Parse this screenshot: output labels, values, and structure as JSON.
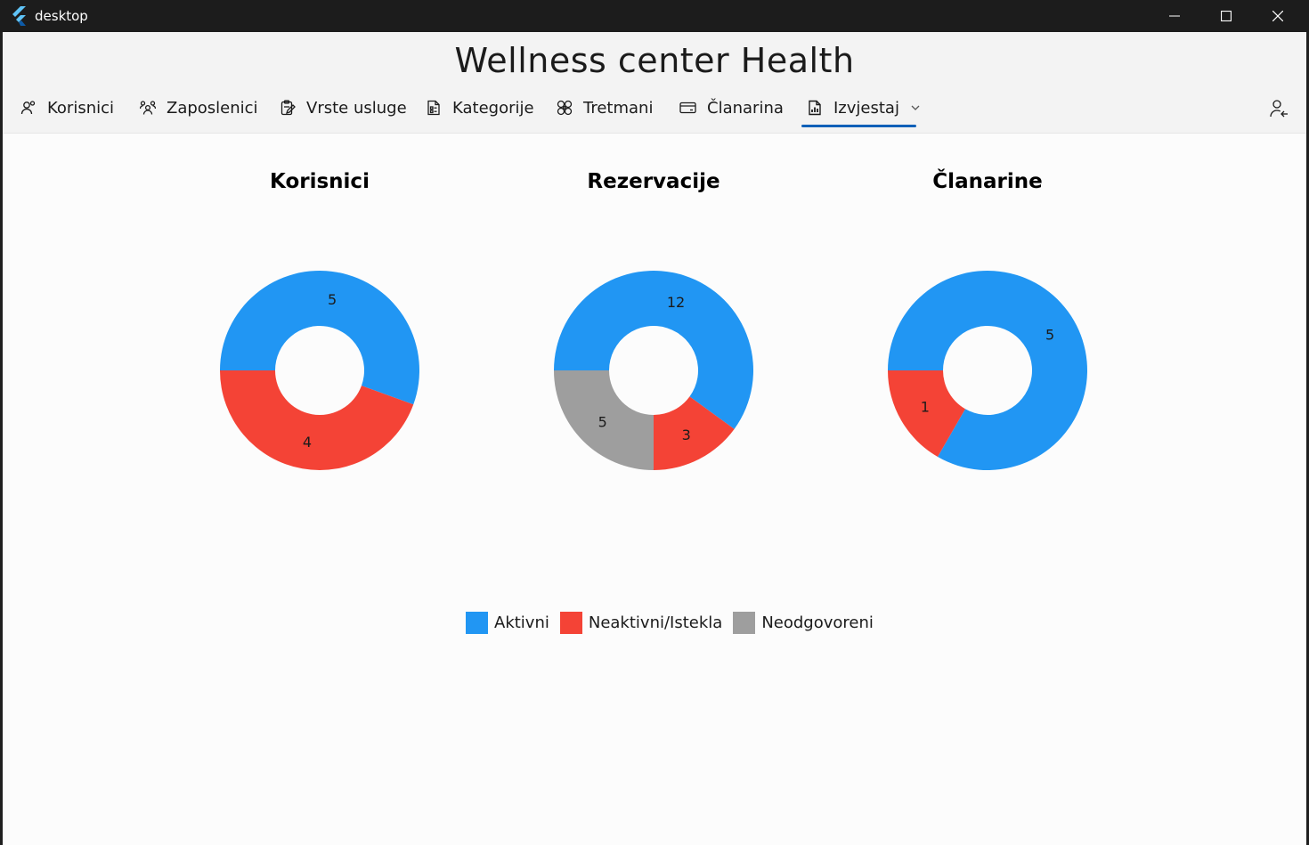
{
  "window": {
    "title": "desktop"
  },
  "app": {
    "title": "Wellness center Health"
  },
  "nav": {
    "items": [
      {
        "label": "Korisnici",
        "icon": "users-icon"
      },
      {
        "label": "Zaposlenici",
        "icon": "team-icon"
      },
      {
        "label": "Vrste usluge",
        "icon": "clipboard-edit-icon"
      },
      {
        "label": "Kategorije",
        "icon": "document-list-icon"
      },
      {
        "label": "Tretmani",
        "icon": "flower-icon"
      },
      {
        "label": "Članarina",
        "icon": "card-icon"
      },
      {
        "label": "Izvjestaj",
        "icon": "report-icon",
        "active": true,
        "dropdown": true
      }
    ],
    "logout_icon": "user-logout-icon"
  },
  "colors": {
    "aktivni": "#2196F3",
    "neaktivni": "#F44336",
    "neodgovoreni": "#9E9E9E",
    "accent": "#1060B8"
  },
  "chart_data": [
    {
      "type": "pie",
      "title": "Korisnici",
      "slices": [
        {
          "label": "Aktivni",
          "value": 5
        },
        {
          "label": "Neaktivni/Istekla",
          "value": 4
        }
      ]
    },
    {
      "type": "pie",
      "title": "Rezervacije",
      "slices": [
        {
          "label": "Aktivni",
          "value": 12
        },
        {
          "label": "Neaktivni/Istekla",
          "value": 3
        },
        {
          "label": "Neodgovoreni",
          "value": 5
        }
      ]
    },
    {
      "type": "pie",
      "title": "Članarine",
      "slices": [
        {
          "label": "Aktivni",
          "value": 5
        },
        {
          "label": "Neaktivni/Istekla",
          "value": 1
        }
      ]
    }
  ],
  "legend": [
    "Aktivni",
    "Neaktivni/Istekla",
    "Neodgovoreni"
  ]
}
